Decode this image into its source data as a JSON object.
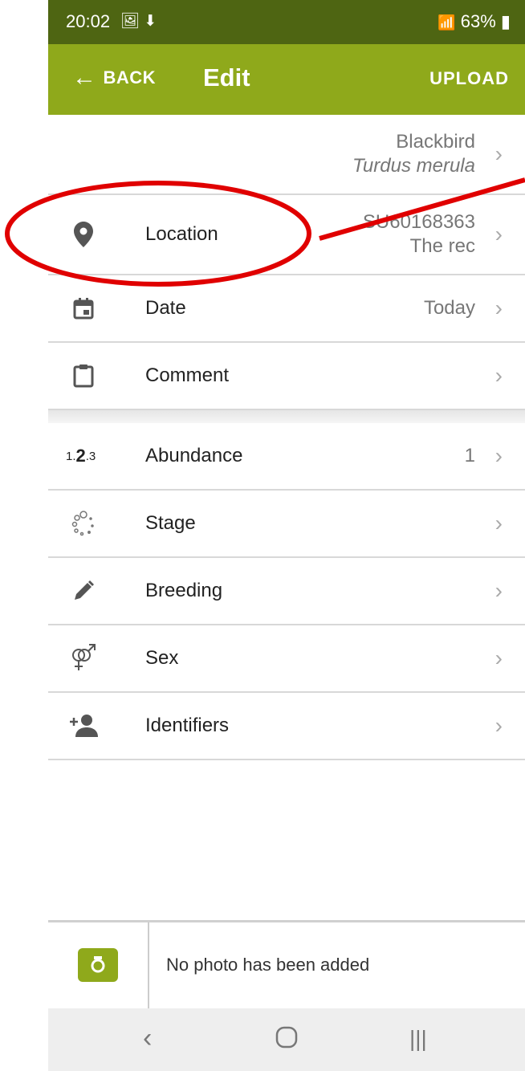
{
  "status_bar": {
    "time": "20:02",
    "notif_icons": "🖼 ⬇",
    "battery": "63%"
  },
  "appbar": {
    "back_label": "BACK",
    "title": "Edit",
    "upload_label": "UPLOAD"
  },
  "species": {
    "common": "Blackbird",
    "scientific": "Turdus merula"
  },
  "rows_top": [
    {
      "label": "Location",
      "value_line1": "SU60168363",
      "value_line2": "The rec",
      "icon": "location-pin-icon"
    },
    {
      "label": "Date",
      "value": "Today",
      "icon": "calendar-icon"
    },
    {
      "label": "Comment",
      "value": "",
      "icon": "clipboard-icon"
    }
  ],
  "rows_bottom": [
    {
      "label": "Abundance",
      "value": "1",
      "icon": "abundance-icon"
    },
    {
      "label": "Stage",
      "value": "",
      "icon": "stage-dots-icon"
    },
    {
      "label": "Breeding",
      "value": "",
      "icon": "pencil-icon"
    },
    {
      "label": "Sex",
      "value": "",
      "icon": "gender-icon"
    },
    {
      "label": "Identifiers",
      "value": "",
      "icon": "add-person-icon"
    }
  ],
  "photo": {
    "empty_text": "No photo has been added"
  },
  "colors": {
    "appbar": "#8fa91b",
    "statusbar": "#4e6512",
    "annotation": "#e00000"
  }
}
